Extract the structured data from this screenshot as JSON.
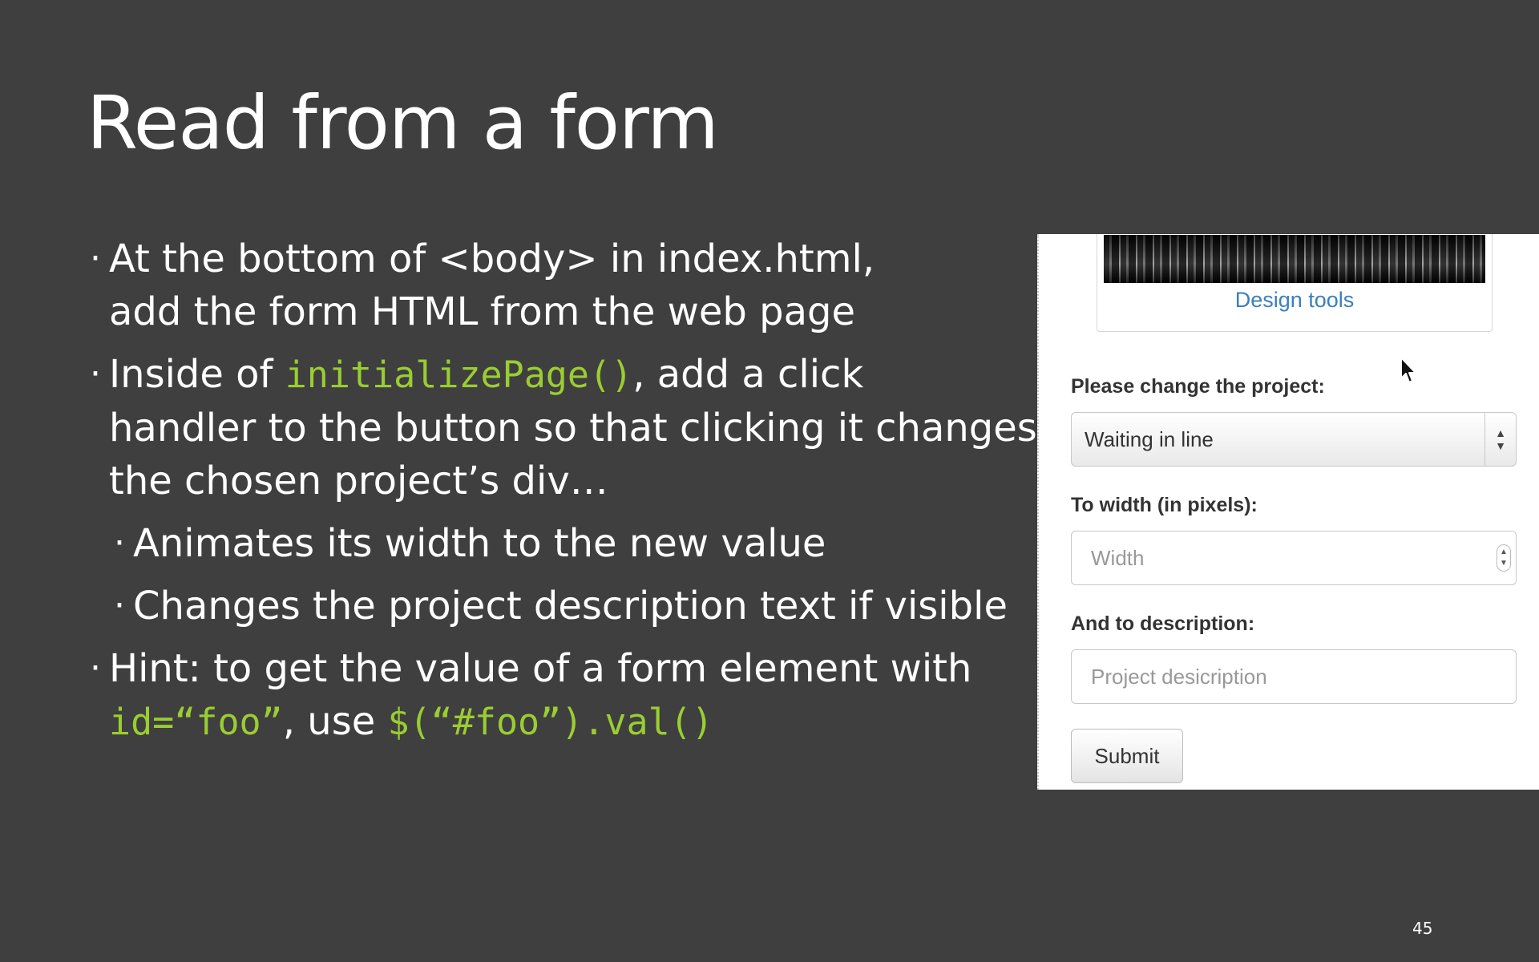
{
  "slide": {
    "title": "Read from a form",
    "page_number": "45"
  },
  "bullets": {
    "b1_line1": "At the bottom of <body> in index.html,",
    "b1_line2": "add the form HTML from the web page",
    "b2_pre": "Inside of ",
    "b2_code": "initializePage()",
    "b2_post": ", add a click",
    "b2_line2": "handler to the button so that clicking it changes",
    "b2_line3": "the chosen project’s div…",
    "sub1": "Animates its width to the new value",
    "sub2": "Changes the project description text if visible",
    "b3_line1": "Hint: to get the value of a form element with",
    "b3_code1": "id=“foo”",
    "b3_mid": ", use ",
    "b3_code2": "$(“#foo”).val()"
  },
  "form": {
    "thumbnail_caption": "Design tools",
    "project_label": "Please change the project:",
    "project_selected": "Waiting in line",
    "width_label": "To width (in pixels):",
    "width_placeholder": "Width",
    "description_label": "And to description:",
    "description_placeholder": "Project desicription",
    "submit_label": "Submit"
  },
  "colors": {
    "background": "#3f3f3f",
    "code": "#9acd32",
    "link": "#3a7fc0"
  },
  "icons": {
    "cursor": "mouse-pointer-icon",
    "select": "chevron-up-down-icon",
    "spinner": "spinner-arrows-icon"
  }
}
